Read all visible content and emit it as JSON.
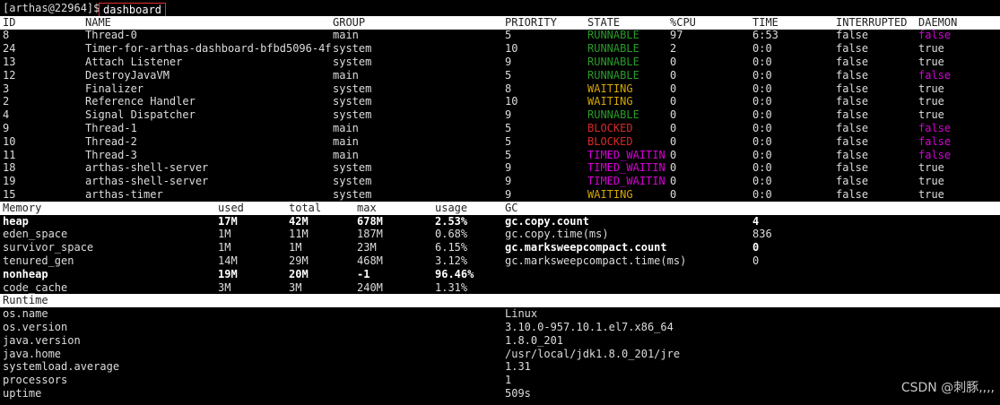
{
  "prompt": {
    "user_host": "[arthas@22964]$",
    "command": "dashboard"
  },
  "colors": {
    "RUNNABLE": "#2a9a2a",
    "WAITING": "#d6a800",
    "BLOCKED": "#d62a2a",
    "TIMED_WAITIN": "#d600d6",
    "false": "#d600d6",
    "true": "#dddddd"
  },
  "threads": {
    "headers": [
      "ID",
      "NAME",
      "GROUP",
      "PRIORITY",
      "STATE",
      "%CPU",
      "TIME",
      "INTERRUPTED",
      "DAEMON"
    ],
    "rows": [
      [
        "8",
        "Thread-0",
        "main",
        "5",
        "RUNNABLE",
        "97",
        "6:53",
        "false",
        "false"
      ],
      [
        "24",
        "Timer-for-arthas-dashboard-bfbd5096-4f",
        "system",
        "10",
        "RUNNABLE",
        "2",
        "0:0",
        "false",
        "true"
      ],
      [
        "13",
        "Attach Listener",
        "system",
        "9",
        "RUNNABLE",
        "0",
        "0:0",
        "false",
        "true"
      ],
      [
        "12",
        "DestroyJavaVM",
        "main",
        "5",
        "RUNNABLE",
        "0",
        "0:0",
        "false",
        "false"
      ],
      [
        "3",
        "Finalizer",
        "system",
        "8",
        "WAITING",
        "0",
        "0:0",
        "false",
        "true"
      ],
      [
        "2",
        "Reference Handler",
        "system",
        "10",
        "WAITING",
        "0",
        "0:0",
        "false",
        "true"
      ],
      [
        "4",
        "Signal Dispatcher",
        "system",
        "9",
        "RUNNABLE",
        "0",
        "0:0",
        "false",
        "true"
      ],
      [
        "9",
        "Thread-1",
        "main",
        "5",
        "BLOCKED",
        "0",
        "0:0",
        "false",
        "false"
      ],
      [
        "10",
        "Thread-2",
        "main",
        "5",
        "BLOCKED",
        "0",
        "0:0",
        "false",
        "false"
      ],
      [
        "11",
        "Thread-3",
        "main",
        "5",
        "TIMED_WAITIN",
        "0",
        "0:0",
        "false",
        "false"
      ],
      [
        "18",
        "arthas-shell-server",
        "system",
        "9",
        "TIMED_WAITIN",
        "0",
        "0:0",
        "false",
        "true"
      ],
      [
        "19",
        "arthas-shell-server",
        "system",
        "9",
        "TIMED_WAITIN",
        "0",
        "0:0",
        "false",
        "true"
      ],
      [
        "15",
        "arthas-timer",
        "system",
        "9",
        "WAITING",
        "0",
        "0:0",
        "false",
        "true"
      ]
    ]
  },
  "memory": {
    "headers": [
      "Memory",
      "used",
      "total",
      "max",
      "usage"
    ],
    "rows": [
      {
        "bold": true,
        "cells": [
          "heap",
          "17M",
          "42M",
          "678M",
          "2.53%"
        ]
      },
      {
        "bold": false,
        "cells": [
          "eden_space",
          "1M",
          "11M",
          "187M",
          "0.68%"
        ]
      },
      {
        "bold": false,
        "cells": [
          "survivor_space",
          "1M",
          "1M",
          "23M",
          "6.15%"
        ]
      },
      {
        "bold": false,
        "cells": [
          "tenured_gen",
          "14M",
          "29M",
          "468M",
          "3.12%"
        ]
      },
      {
        "bold": true,
        "cells": [
          "nonheap",
          "19M",
          "20M",
          "-1",
          "96.46%"
        ]
      },
      {
        "bold": false,
        "cells": [
          "code_cache",
          "3M",
          "3M",
          "240M",
          "1.31%"
        ]
      }
    ]
  },
  "gc": {
    "header": "GC",
    "rows": [
      {
        "bold": true,
        "cells": [
          "gc.copy.count",
          "4"
        ]
      },
      {
        "bold": false,
        "cells": [
          "gc.copy.time(ms)",
          "836"
        ]
      },
      {
        "bold": true,
        "cells": [
          "gc.marksweepcompact.count",
          "0"
        ]
      },
      {
        "bold": false,
        "cells": [
          "gc.marksweepcompact.time(ms)",
          "0"
        ]
      }
    ]
  },
  "runtime": {
    "header": "Runtime",
    "rows": [
      [
        "os.name",
        "Linux"
      ],
      [
        "os.version",
        "3.10.0-957.10.1.el7.x86_64"
      ],
      [
        "java.version",
        "1.8.0_201"
      ],
      [
        "java.home",
        "/usr/local/jdk1.8.0_201/jre"
      ],
      [
        "systemload.average",
        "1.31"
      ],
      [
        "processors",
        "1"
      ],
      [
        "uptime",
        "509s"
      ]
    ]
  },
  "watermark": "CSDN @刺豚,,,,"
}
